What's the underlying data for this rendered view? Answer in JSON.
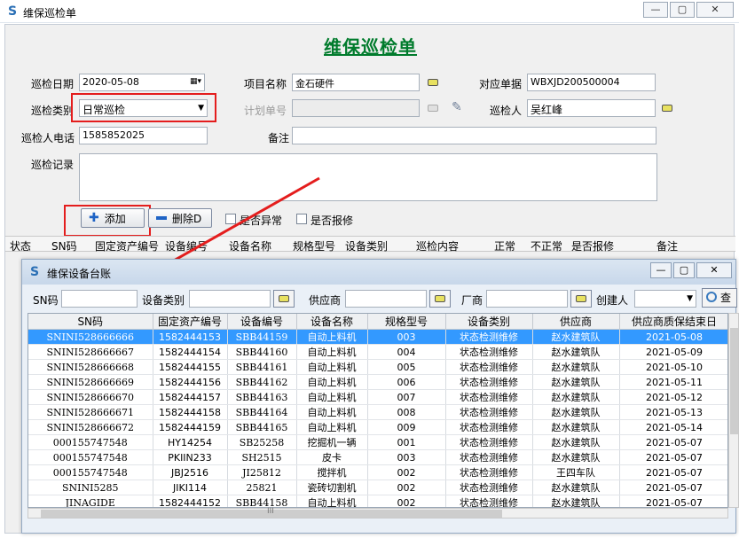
{
  "window": {
    "title": "维保巡检单",
    "buttons": {
      "minimize": "—",
      "maximize": "▢",
      "close": "✕"
    }
  },
  "form": {
    "heading": "维保巡检单",
    "inspect_date_label": "巡检日期",
    "inspect_date": "2020-05-08",
    "project_label": "项目名称",
    "project": "金石硬件",
    "order_label": "对应单据",
    "order": "WBXJD200500004",
    "category_label": "巡检类别",
    "category": "日常巡检",
    "plan_label": "计划单号",
    "plan": "",
    "inspector_label": "巡检人",
    "inspector": "吴红峰",
    "phone_label": "巡检人电话",
    "phone": "1585852025",
    "remark_label": "备注",
    "remark": "",
    "record_label": "巡检记录",
    "record": "",
    "add_button": "添加",
    "delete_button": "删除D",
    "abnormal_label": "是否异常",
    "report_label": "是否报修"
  },
  "detail_headers": [
    "状态",
    "SN码",
    "固定资产编号",
    "设备编号",
    "设备名称",
    "规格型号",
    "设备类别",
    "巡检内容",
    "正常",
    "不正常",
    "是否报修",
    "备注"
  ],
  "popup": {
    "title": "维保设备台账",
    "filters": {
      "sn_label": "SN码",
      "type_label": "设备类别",
      "supplier_label": "供应商",
      "vendor_label": "厂商",
      "creator_label": "创建人",
      "query_label": "查"
    },
    "columns": [
      "SN码",
      "固定资产编号",
      "设备编号",
      "设备名称",
      "规格型号",
      "设备类别",
      "供应商",
      "供应商质保结束日"
    ],
    "rows": [
      [
        "SNINI528666666",
        "1582444153",
        "SBB44159",
        "自动上料机",
        "003",
        "状态检测维修",
        "赵水建筑队",
        "2021-05-08"
      ],
      [
        "SNINI528666667",
        "1582444154",
        "SBB44160",
        "自动上料机",
        "004",
        "状态检测维修",
        "赵水建筑队",
        "2021-05-09"
      ],
      [
        "SNINI528666668",
        "1582444155",
        "SBB44161",
        "自动上料机",
        "005",
        "状态检测维修",
        "赵水建筑队",
        "2021-05-10"
      ],
      [
        "SNINI528666669",
        "1582444156",
        "SBB44162",
        "自动上料机",
        "006",
        "状态检测维修",
        "赵水建筑队",
        "2021-05-11"
      ],
      [
        "SNINI528666670",
        "1582444157",
        "SBB44163",
        "自动上料机",
        "007",
        "状态检测维修",
        "赵水建筑队",
        "2021-05-12"
      ],
      [
        "SNINI528666671",
        "1582444158",
        "SBB44164",
        "自动上料机",
        "008",
        "状态检测维修",
        "赵水建筑队",
        "2021-05-13"
      ],
      [
        "SNINI528666672",
        "1582444159",
        "SBB44165",
        "自动上料机",
        "009",
        "状态检测维修",
        "赵水建筑队",
        "2021-05-14"
      ],
      [
        "000155747548",
        "HY14254",
        "SB25258",
        "挖掘机一辆",
        "001",
        "状态检测维修",
        "赵水建筑队",
        "2021-05-07"
      ],
      [
        "000155747548",
        "PKIIN233",
        "SH2515",
        "皮卡",
        "003",
        "状态检测维修",
        "赵水建筑队",
        "2021-05-07"
      ],
      [
        "000155747548",
        "JBJ2516",
        "JI25812",
        "搅拌机",
        "002",
        "状态检测维修",
        "王四车队",
        "2021-05-07"
      ],
      [
        "SNINI5285",
        "JIKI114",
        "25821",
        "瓷砖切割机",
        "002",
        "状态检测维修",
        "赵水建筑队",
        "2021-05-07"
      ],
      [
        "JINAGIDE",
        "1582444152",
        "SBB44158",
        "自动上料机",
        "002",
        "状态检测维修",
        "赵水建筑队",
        "2021-05-07"
      ]
    ],
    "scroll_mark": "III"
  },
  "colors": {
    "title_green": "#007b2c",
    "highlight_red": "#e41d1d",
    "selection_blue": "#3399ff"
  }
}
